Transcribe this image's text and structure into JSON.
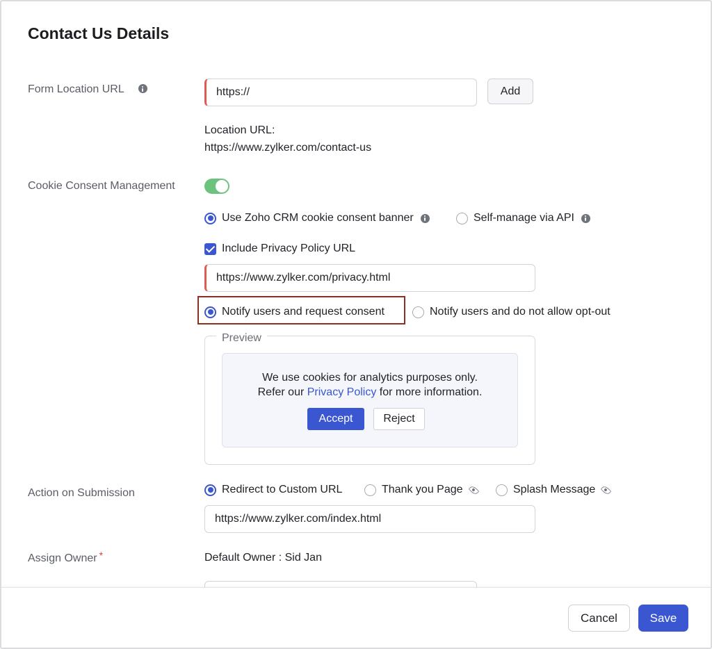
{
  "page_title": "Contact Us Details",
  "form_location": {
    "label": "Form Location URL",
    "input_value": "https://",
    "add_label": "Add",
    "location_url_label": "Location URL:",
    "location_url_value": "https://www.zylker.com/contact-us"
  },
  "cookie_consent": {
    "label": "Cookie Consent Management",
    "enabled": true,
    "banner_mode_options": [
      {
        "label": "Use Zoho CRM cookie consent banner",
        "selected": true
      },
      {
        "label": "Self-manage via API",
        "selected": false
      }
    ],
    "include_privacy_label": "Include Privacy Policy URL",
    "include_privacy_checked": true,
    "privacy_url_value": "https://www.zylker.com/privacy.html",
    "consent_options": [
      {
        "label": "Notify users and request consent",
        "selected": true
      },
      {
        "label": "Notify users and do not allow opt-out",
        "selected": false
      }
    ],
    "preview": {
      "legend": "Preview",
      "line1": "We use cookies for analytics purposes only.",
      "line2_before": "Refer our ",
      "line2_link": "Privacy Policy",
      "line2_after": " for more information.",
      "accept_label": "Accept",
      "reject_label": "Reject"
    }
  },
  "action_on_submission": {
    "label": "Action on Submission",
    "options": [
      {
        "label": "Redirect to Custom URL",
        "selected": true
      },
      {
        "label": "Thank you Page",
        "selected": false
      },
      {
        "label": "Splash Message",
        "selected": false
      }
    ],
    "url_value": "https://www.zylker.com/index.html"
  },
  "assign_owner": {
    "label": "Assign Owner",
    "required_mark": "*",
    "default_owner": "Default Owner : Sid Jan"
  },
  "footer": {
    "cancel_label": "Cancel",
    "save_label": "Save"
  },
  "colors": {
    "accent": "#3a56d0",
    "toggle_on": "#6dc27e",
    "required_border": "#e05a55",
    "highlight_border": "#8e2f24"
  }
}
